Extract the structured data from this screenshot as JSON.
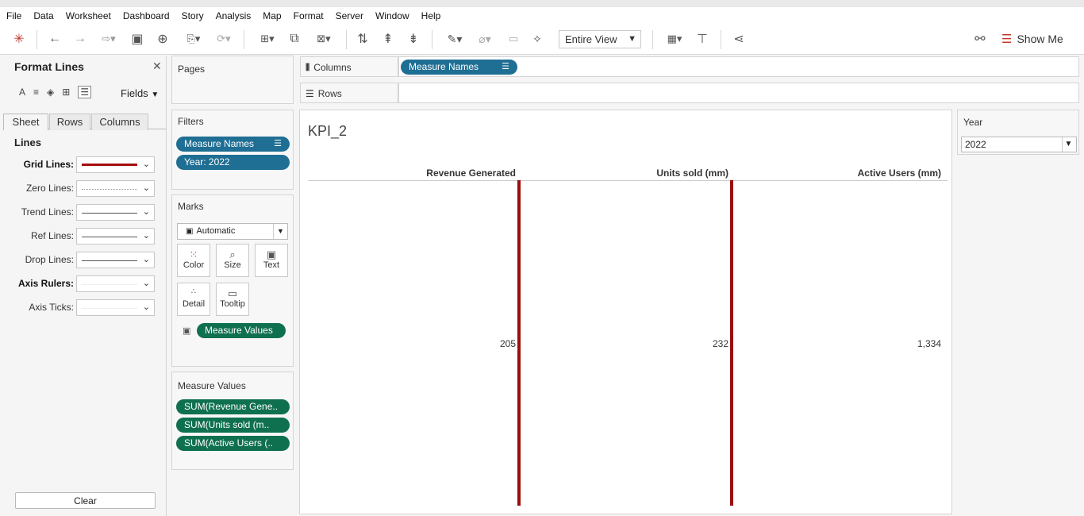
{
  "menu": [
    "File",
    "Data",
    "Worksheet",
    "Dashboard",
    "Story",
    "Analysis",
    "Map",
    "Format",
    "Server",
    "Window",
    "Help"
  ],
  "toolbar": {
    "fit_select": "Entire View",
    "show_me": "Show Me"
  },
  "format_pane": {
    "title": "Format Lines",
    "fields_label": "Fields",
    "tabs": [
      "Sheet",
      "Rows",
      "Columns"
    ],
    "section": "Lines",
    "rows": [
      {
        "label": "Grid Lines:",
        "bold": true,
        "line": "solid-thick-red"
      },
      {
        "label": "Zero Lines:",
        "bold": false,
        "line": "dotted"
      },
      {
        "label": "Trend Lines:",
        "bold": false,
        "line": "solid"
      },
      {
        "label": "Ref Lines:",
        "bold": false,
        "line": "solid"
      },
      {
        "label": "Drop Lines:",
        "bold": false,
        "line": "solid"
      },
      {
        "label": "Axis Rulers:",
        "bold": true,
        "line": "none"
      },
      {
        "label": "Axis Ticks:",
        "bold": false,
        "line": "none"
      }
    ],
    "clear_label": "Clear",
    "grid_line_color": "#a50e0e"
  },
  "pages": {
    "title": "Pages"
  },
  "filters": {
    "title": "Filters",
    "pills": [
      "Measure Names",
      "Year: 2022"
    ]
  },
  "marks": {
    "title": "Marks",
    "type": "Automatic",
    "buttons": [
      "Color",
      "Size",
      "Text",
      "Detail",
      "Tooltip"
    ],
    "text_pill": "Measure Values"
  },
  "measure_values": {
    "title": "Measure Values",
    "pills": [
      "SUM(Revenue Gene..",
      "SUM(Units sold (m..",
      "SUM(Active Users (.."
    ]
  },
  "shelves": {
    "columns_label": "Columns",
    "columns_pill": "Measure Names",
    "rows_label": "Rows"
  },
  "view": {
    "title": "KPI_2",
    "columns": [
      {
        "header": "Revenue Generated",
        "value": "205"
      },
      {
        "header": "Units sold (mm)",
        "value": "232"
      },
      {
        "header": "Active Users (mm)",
        "value": "1,334"
      }
    ]
  },
  "year_filter": {
    "title": "Year",
    "value": "2022"
  },
  "colors": {
    "pill_blue": "#1f6e94",
    "pill_green": "#0f7050",
    "grid_red": "#9b0d0d"
  }
}
